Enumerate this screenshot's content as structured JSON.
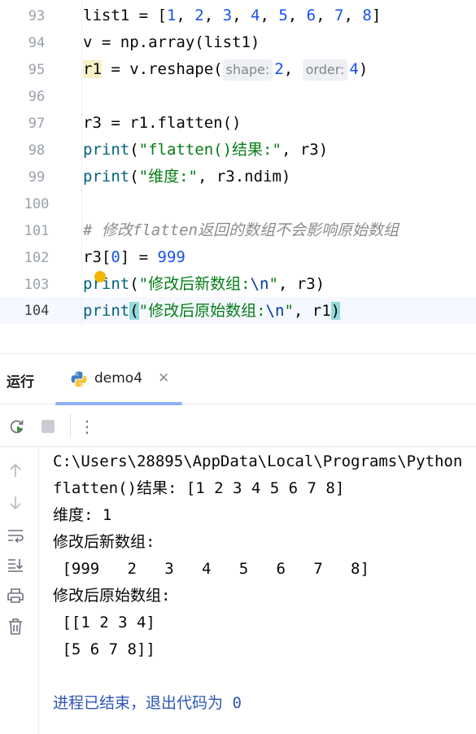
{
  "editor": {
    "lines": [
      {
        "num": "93"
      },
      {
        "num": "94"
      },
      {
        "num": "95"
      },
      {
        "num": "96"
      },
      {
        "num": "97"
      },
      {
        "num": "98"
      },
      {
        "num": "99"
      },
      {
        "num": "100"
      },
      {
        "num": "101"
      },
      {
        "num": "102"
      },
      {
        "num": "103"
      },
      {
        "num": "104"
      }
    ],
    "code": {
      "l93": {
        "a": "list1 = [",
        "n1": "1",
        "n2": "2",
        "n3": "3",
        "n4": "4",
        "n5": "5",
        "n6": "6",
        "n7": "7",
        "n8": "8",
        "end": "]"
      },
      "l94": {
        "text": "v = np.array(list1)"
      },
      "l95": {
        "var": "r1",
        "mid": " = v.reshape(",
        "hint1": "shape:",
        "val1": "2",
        "comma": ", ",
        "hint2": "order:",
        "val2": "4",
        "end": ")"
      },
      "l97": {
        "text": "r3 = r1.flatten()"
      },
      "l98": {
        "fn": "print",
        "open": "(",
        "str": "\"flatten()结果:\"",
        "rest": ", r3)"
      },
      "l99": {
        "fn": "print",
        "open": "(",
        "str": "\"维度:\"",
        "rest": ", r3.ndim)"
      },
      "l101": {
        "comment": "# 修改flatten返回的数组不会影响原始数组"
      },
      "l102": {
        "a": "r3[",
        "idx": "0",
        "b": "] = ",
        "val": "999"
      },
      "l103": {
        "fn": "print",
        "open": "(",
        "str": "\"修改后新数组:",
        "esc": "\\n",
        "strend": "\"",
        "rest": ", r3)"
      },
      "l104": {
        "fn": "print",
        "open": "(",
        "str": "\"修改后原始数组:",
        "esc": "\\n",
        "strend": "\"",
        "rest": ", r1",
        "close": ")"
      }
    }
  },
  "toolwindow": {
    "title": "运行",
    "tab": {
      "label": "demo4",
      "close": "✕"
    },
    "toolbar": {
      "rerun": "rerun-icon",
      "stop": "stop-icon",
      "more": "⋮"
    },
    "sidebar": [
      "arrow-up-icon",
      "arrow-down-icon",
      "soft-wrap-icon",
      "scroll-to-end-icon",
      "print-icon",
      "trash-icon"
    ]
  },
  "console": {
    "lines": [
      "C:\\Users\\28895\\AppData\\Local\\Programs\\Python",
      "flatten()结果: [1 2 3 4 5 6 7 8]",
      "维度: 1",
      "修改后新数组:",
      " [999   2   3   4   5   6   7   8]",
      "修改后原始数组:",
      " [[1 2 3 4]",
      " [5 6 7 8]]",
      "",
      "进程已结束，退出代码为 0"
    ]
  },
  "colors": {
    "accent": "#3574f0",
    "string": "#067d17",
    "number": "#1750eb",
    "function": "#00627a"
  }
}
